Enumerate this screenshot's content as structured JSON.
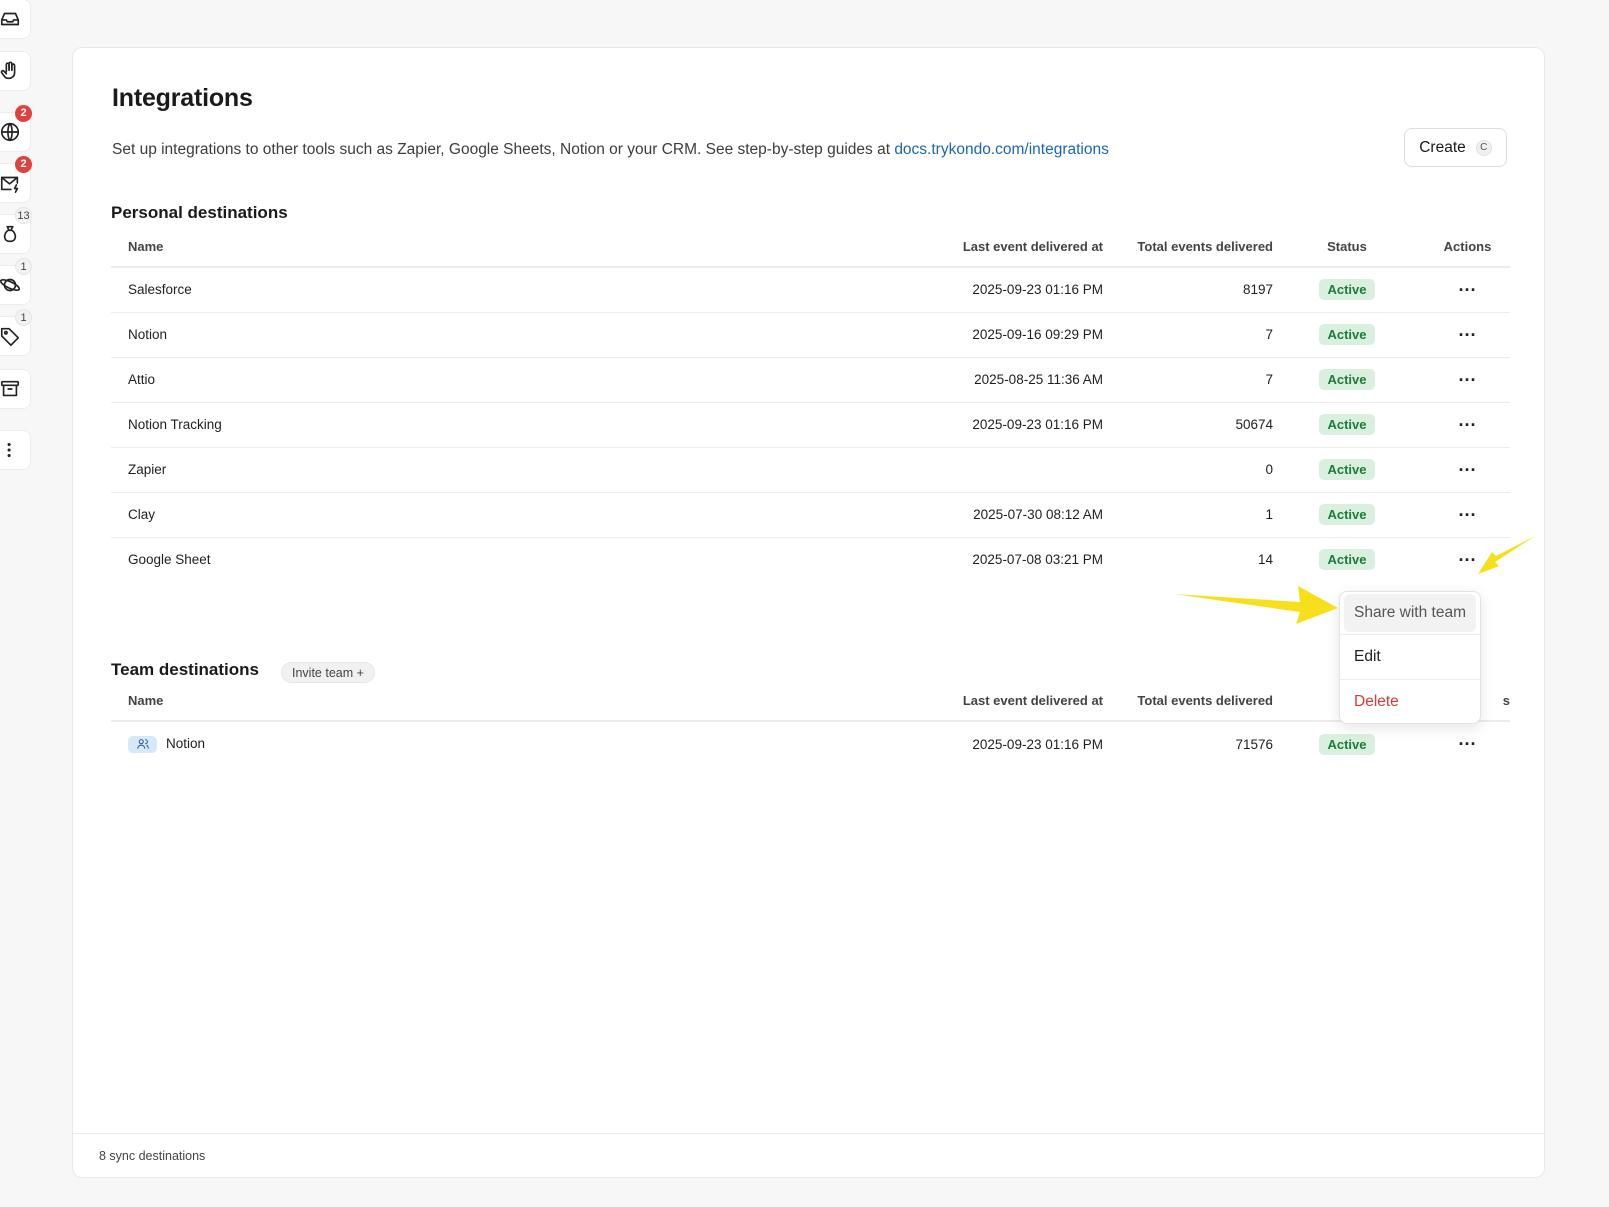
{
  "rail": {
    "items": [
      {
        "icon": "inbox-icon",
        "badge": ""
      },
      {
        "icon": "hand-wave-icon",
        "badge": ""
      },
      {
        "icon": "globe-icon",
        "badge": "2",
        "badge_style": "red"
      },
      {
        "icon": "mail-bolt-icon",
        "badge": "2",
        "badge_style": "red"
      },
      {
        "icon": "money-bag-icon",
        "badge": "13",
        "badge_style": "plain"
      },
      {
        "icon": "planet-icon",
        "badge": "1",
        "badge_style": "plain"
      },
      {
        "icon": "tag-icon",
        "badge": "1",
        "badge_style": "plain"
      },
      {
        "icon": "archive-icon",
        "badge": ""
      },
      {
        "icon": "more-vertical-icon",
        "badge": ""
      }
    ]
  },
  "page": {
    "title": "Integrations",
    "subtitle": "Set up integrations to other tools such as Zapier, Google Sheets, Notion or your CRM. See step-by-step guides at ",
    "docs_link": "docs.trykondo.com/integrations",
    "create_label": "Create",
    "create_shortcut": "C"
  },
  "columns": {
    "name": "Name",
    "last_event": "Last event delivered at",
    "total_events": "Total events delivered",
    "status": "Status",
    "actions": "Actions"
  },
  "personal": {
    "title": "Personal destinations",
    "rows": [
      {
        "name": "Salesforce",
        "last_event": "2025-09-23 01:16 PM",
        "total": "8197",
        "status": "Active"
      },
      {
        "name": "Notion",
        "last_event": "2025-09-16 09:29 PM",
        "total": "7",
        "status": "Active"
      },
      {
        "name": "Attio",
        "last_event": "2025-08-25 11:36 AM",
        "total": "7",
        "status": "Active"
      },
      {
        "name": "Notion Tracking",
        "last_event": "2025-09-23 01:16 PM",
        "total": "50674",
        "status": "Active"
      },
      {
        "name": "Zapier",
        "last_event": "",
        "total": "0",
        "status": "Active"
      },
      {
        "name": "Clay",
        "last_event": "2025-07-30 08:12 AM",
        "total": "1",
        "status": "Active"
      },
      {
        "name": "Google Sheet",
        "last_event": "2025-07-08 03:21 PM",
        "total": "14",
        "status": "Active"
      }
    ]
  },
  "team": {
    "title": "Team destinations",
    "invite_label": "Invite team +",
    "actions_header_partial": "s",
    "rows": [
      {
        "name": "Notion",
        "icon": "team-icon",
        "last_event": "2025-09-23 01:16 PM",
        "total": "71576",
        "status": "Active"
      }
    ]
  },
  "action_glyph": "···",
  "menu": {
    "items": [
      "Share with team",
      "Edit",
      "Delete"
    ]
  },
  "footer": {
    "count_text": "8 sync destinations"
  },
  "colors": {
    "link": "#1b67b5",
    "active_bg": "#d9f0df",
    "active_text": "#1f7a3c",
    "danger": "#d23c3c",
    "annotation_arrow": "#f7e01b",
    "badge_red": "#e0413d"
  }
}
